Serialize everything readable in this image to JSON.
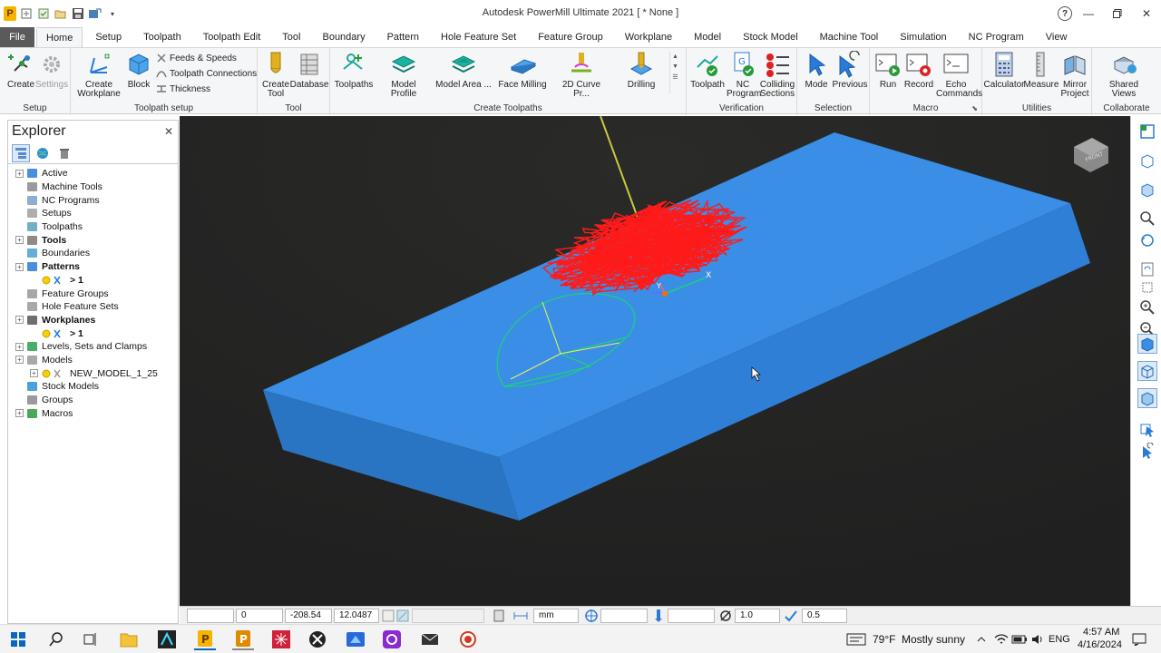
{
  "window": {
    "title": "Autodesk PowerMill Ultimate 2021    [  * None ]"
  },
  "tabs": [
    "File",
    "Home",
    "Setup",
    "Toolpath",
    "Toolpath Edit",
    "Tool",
    "Boundary",
    "Pattern",
    "Hole Feature Set",
    "Feature Group",
    "Workplane",
    "Model",
    "Stock Model",
    "Machine Tool",
    "Simulation",
    "NC Program",
    "View"
  ],
  "ribbon": {
    "setup": {
      "label": "Setup",
      "create": "Create",
      "settings": "Settings"
    },
    "toolpath_setup": {
      "label": "Toolpath setup",
      "create_workplane": "Create Workplane",
      "block": "Block",
      "feeds_speeds": "Feeds & Speeds",
      "toolpath_connections": "Toolpath Connections",
      "thickness": "Thickness"
    },
    "tool": {
      "label": "Tool",
      "create_tool": "Create Tool",
      "database": "Database"
    },
    "create_toolpaths": {
      "label": "Create Toolpaths",
      "toolpaths": "Toolpaths",
      "model_profile": "Model Profile",
      "model_area": "Model Area ...",
      "face_milling": "Face Milling",
      "curve": "2D Curve Pr...",
      "drilling": "Drilling"
    },
    "verification": {
      "label": "Verification",
      "toolpath": "Toolpath",
      "nc_program": "NC Program",
      "colliding_sections": "Colliding Sections"
    },
    "selection": {
      "label": "Selection",
      "mode": "Mode",
      "previous": "Previous"
    },
    "macro": {
      "label": "Macro",
      "run": "Run",
      "record": "Record",
      "echo_commands": "Echo Commands"
    },
    "utilities": {
      "label": "Utilities",
      "calculator": "Calculator",
      "measure": "Measure",
      "mirror_project": "Mirror Project"
    },
    "collaborate": {
      "label": "Collaborate",
      "shared_views": "Shared Views"
    }
  },
  "explorer": {
    "title": "Explorer",
    "items": [
      {
        "label": "Active",
        "bold": false,
        "indent": 0,
        "expander": true
      },
      {
        "label": "Machine Tools",
        "bold": false,
        "indent": 0,
        "expander": false
      },
      {
        "label": "NC Programs",
        "bold": false,
        "indent": 0,
        "expander": false
      },
      {
        "label": "Setups",
        "bold": false,
        "indent": 0,
        "expander": false
      },
      {
        "label": "Toolpaths",
        "bold": false,
        "indent": 0,
        "expander": false
      },
      {
        "label": "Tools",
        "bold": true,
        "indent": 0,
        "expander": true
      },
      {
        "label": "Boundaries",
        "bold": false,
        "indent": 0,
        "expander": false
      },
      {
        "label": "Patterns",
        "bold": true,
        "indent": 0,
        "expander": true
      },
      {
        "label": "> 1",
        "bold": true,
        "indent": 1,
        "expander": false
      },
      {
        "label": "Feature Groups",
        "bold": false,
        "indent": 0,
        "expander": false
      },
      {
        "label": "Hole Feature Sets",
        "bold": false,
        "indent": 0,
        "expander": false
      },
      {
        "label": "Workplanes",
        "bold": true,
        "indent": 0,
        "expander": true
      },
      {
        "label": "> 1",
        "bold": true,
        "indent": 1,
        "expander": false
      },
      {
        "label": "Levels, Sets and Clamps",
        "bold": false,
        "indent": 0,
        "expander": true
      },
      {
        "label": "Models",
        "bold": false,
        "indent": 0,
        "expander": true
      },
      {
        "label": "NEW_MODEL_1_25",
        "bold": false,
        "indent": 1,
        "expander": true
      },
      {
        "label": "Stock Models",
        "bold": false,
        "indent": 0,
        "expander": false
      },
      {
        "label": "Groups",
        "bold": false,
        "indent": 0,
        "expander": false
      },
      {
        "label": "Macros",
        "bold": false,
        "indent": 0,
        "expander": true
      }
    ]
  },
  "statusbar": {
    "x": "0",
    "y": "-208.54",
    "z": "12.0487",
    "units": "mm",
    "diameter": "1.0",
    "tolerance": "0.5"
  },
  "taskbar": {
    "weather_temp": "79°F",
    "weather_desc": "Mostly sunny",
    "lang": "ENG",
    "time": "4:57 AM",
    "date": "4/16/2024"
  },
  "colors": {
    "block": "#3a8ee6",
    "block_side": "#2f77c2",
    "toolpath": "#ff1a1a",
    "viewport_bg": "#232323"
  }
}
